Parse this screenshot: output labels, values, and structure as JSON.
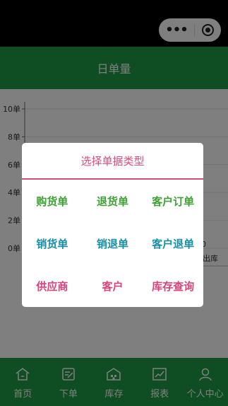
{
  "capsule": {
    "more": "•••"
  },
  "header": {
    "title": "日单量"
  },
  "chart_data": {
    "type": "bar",
    "ylabel": "",
    "xlabel": "",
    "yticks": [
      "10单",
      "8单",
      "6单",
      "4单",
      "2单",
      "0单"
    ],
    "ylim": [
      0,
      10
    ],
    "categories": [
      "",
      "出库"
    ],
    "values": [
      0,
      0
    ],
    "partial_x_label": "0"
  },
  "dialog": {
    "title": "选择单据类型",
    "options": [
      {
        "label": "购货单",
        "color": "#3fa035"
      },
      {
        "label": "退货单",
        "color": "#3fa035"
      },
      {
        "label": "客户订单",
        "color": "#3fa035"
      },
      {
        "label": "销货单",
        "color": "#1b8fa2"
      },
      {
        "label": "销退单",
        "color": "#1b8fa2"
      },
      {
        "label": "客户退单",
        "color": "#1b8fa2"
      },
      {
        "label": "供应商",
        "color": "#d9427a"
      },
      {
        "label": "客户",
        "color": "#d9427a"
      },
      {
        "label": "库存查询",
        "color": "#d9427a"
      }
    ]
  },
  "tabbar": {
    "items": [
      {
        "label": "首页",
        "icon": "home-icon"
      },
      {
        "label": "下单",
        "icon": "edit-order-icon"
      },
      {
        "label": "库存",
        "icon": "warehouse-icon"
      },
      {
        "label": "报表",
        "icon": "report-chart-icon"
      },
      {
        "label": "个人中心",
        "icon": "user-icon"
      }
    ]
  }
}
